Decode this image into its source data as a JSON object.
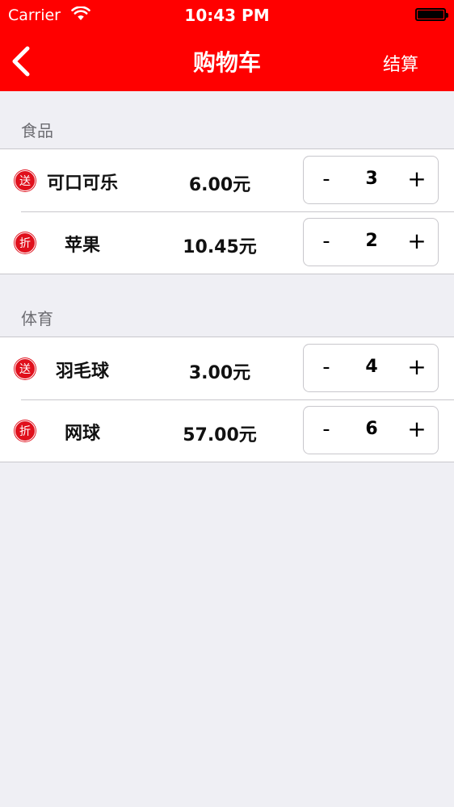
{
  "status_bar": {
    "carrier": "Carrier",
    "time": "10:43 PM"
  },
  "nav": {
    "title": "购物车",
    "right_label": "结算",
    "back_icon": "chevron-left-icon"
  },
  "colors": {
    "header": "#ff0000",
    "badge": "#e0101c",
    "background": "#efeff4"
  },
  "sections": [
    {
      "title": "食品",
      "items": [
        {
          "badge": "送",
          "name": "可口可乐",
          "price": "6.00元",
          "minus": "-",
          "quantity": "3",
          "plus": "+"
        },
        {
          "badge": "折",
          "name": "苹果",
          "price": "10.45元",
          "minus": "-",
          "quantity": "2",
          "plus": "+"
        }
      ]
    },
    {
      "title": "体育",
      "items": [
        {
          "badge": "送",
          "name": "羽毛球",
          "price": "3.00元",
          "minus": "-",
          "quantity": "4",
          "plus": "+"
        },
        {
          "badge": "折",
          "name": "网球",
          "price": "57.00元",
          "minus": "-",
          "quantity": "6",
          "plus": "+"
        }
      ]
    }
  ]
}
